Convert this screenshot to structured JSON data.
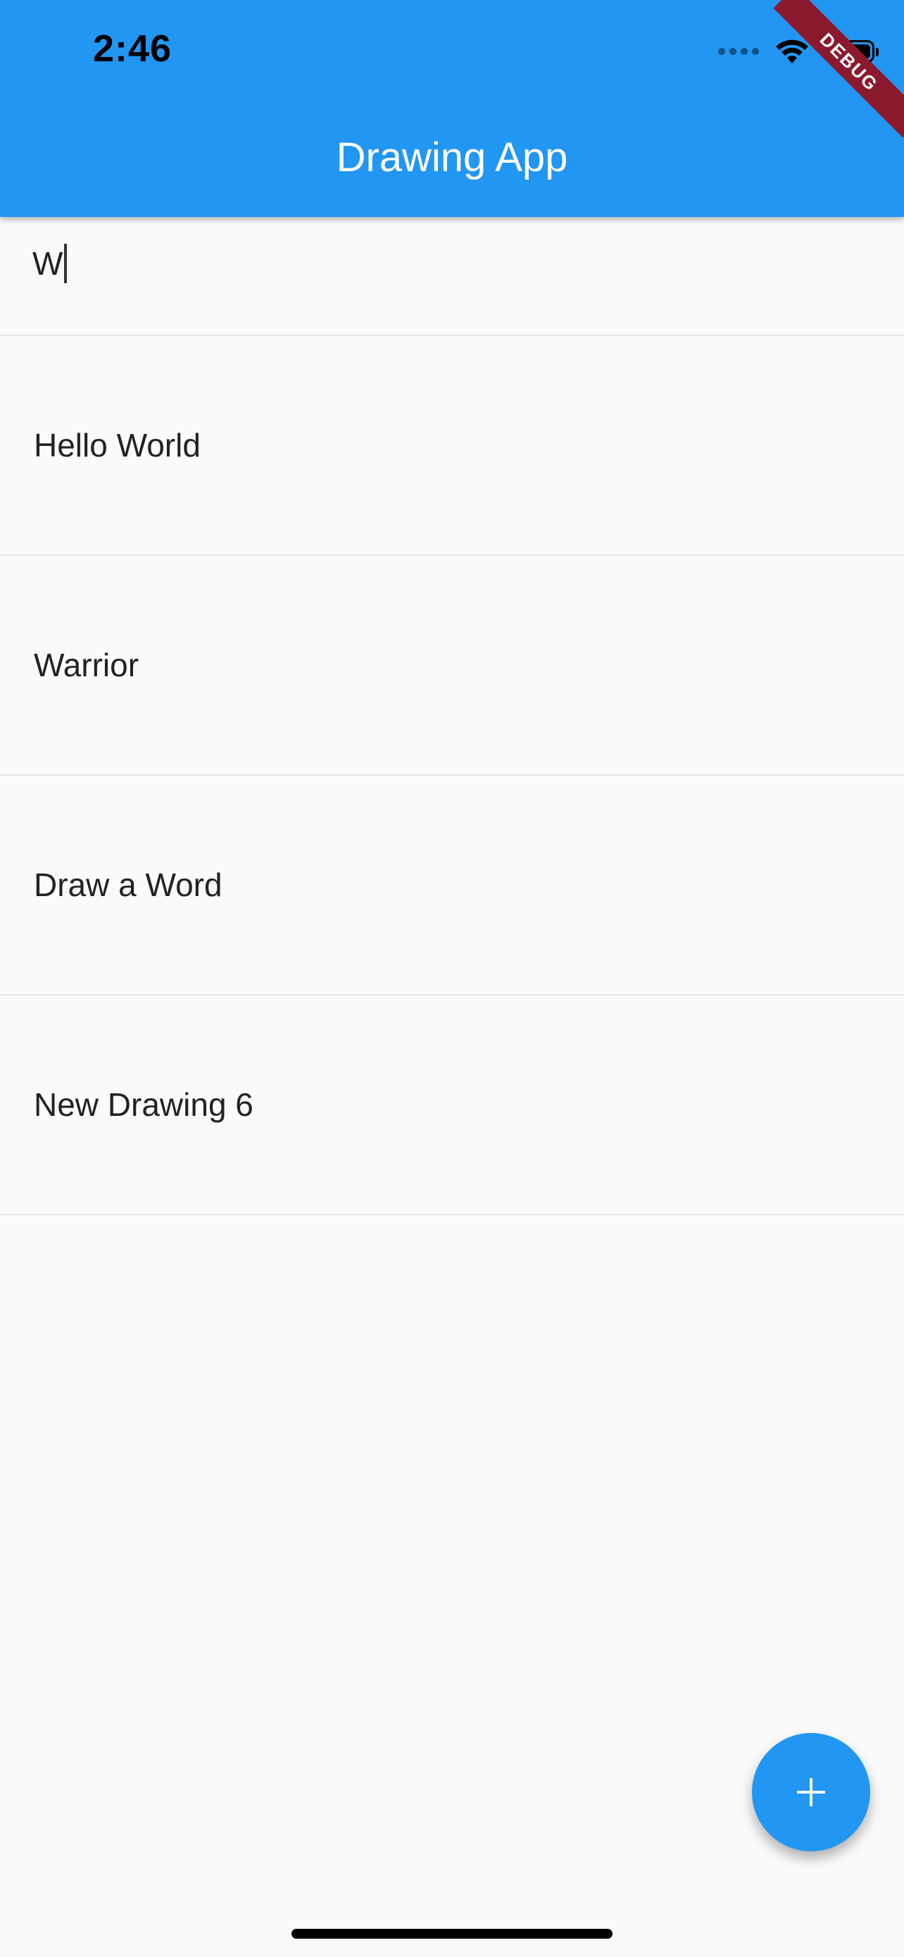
{
  "status_bar": {
    "time": "2:46"
  },
  "app_bar": {
    "title": "Drawing App",
    "color": "#2196f3"
  },
  "debug_banner": {
    "label": "DEBUG",
    "color": "#8b1a2e"
  },
  "search": {
    "value": "W"
  },
  "drawings": [
    {
      "label": "Hello World"
    },
    {
      "label": "Warrior"
    },
    {
      "label": "Draw a Word"
    },
    {
      "label": "New Drawing 6"
    }
  ],
  "fab": {
    "icon": "plus-icon",
    "color": "#2196f3"
  },
  "icons": [
    "signal-dots-icon",
    "wifi-icon",
    "battery-icon",
    "plus-icon"
  ]
}
